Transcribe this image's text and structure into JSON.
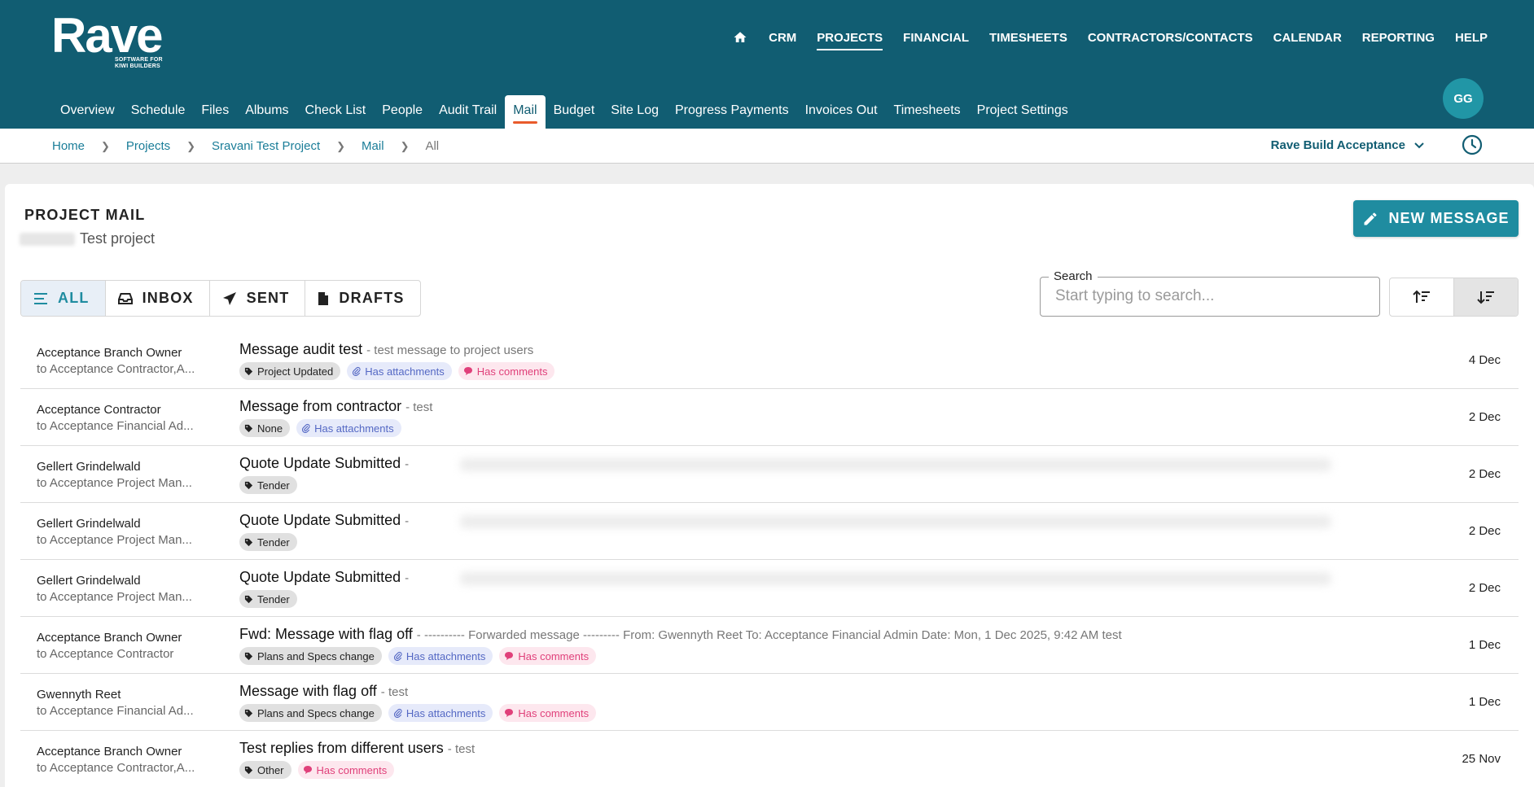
{
  "brand": {
    "name": "Rave",
    "tagline": "SOFTWARE FOR KIWI BUILDERS"
  },
  "topnav": {
    "items": [
      "CRM",
      "PROJECTS",
      "FINANCIAL",
      "TIMESHEETS",
      "CONTRACTORS/CONTACTS",
      "CALENDAR",
      "REPORTING",
      "HELP"
    ],
    "active": "PROJECTS"
  },
  "user": {
    "initials": "GG"
  },
  "subnav": {
    "tabs": [
      "Overview",
      "Schedule",
      "Files",
      "Albums",
      "Check List",
      "People",
      "Audit Trail",
      "Mail",
      "Budget",
      "Site Log",
      "Progress Payments",
      "Invoices Out",
      "Timesheets",
      "Project Settings"
    ],
    "active": "Mail"
  },
  "breadcrumb": [
    "Home",
    "Projects",
    "Sravani Test Project",
    "Mail",
    "All"
  ],
  "project_selector": {
    "value": "Rave Build Acceptance"
  },
  "page": {
    "title": "PROJECT MAIL",
    "subtitle": "Test project",
    "new_message_label": "NEW MESSAGE"
  },
  "filters": [
    {
      "label": "ALL",
      "icon": "list-icon",
      "active": true
    },
    {
      "label": "INBOX",
      "icon": "inbox-icon",
      "active": false
    },
    {
      "label": "SENT",
      "icon": "send-icon",
      "active": false
    },
    {
      "label": "DRAFTS",
      "icon": "file-icon",
      "active": false
    }
  ],
  "search": {
    "label": "Search",
    "placeholder": "Start typing to search...",
    "value": ""
  },
  "messages": [
    {
      "from": "Acceptance Branch Owner",
      "to": "to Acceptance Contractor,A...",
      "subject": "Message audit test",
      "preview": "- test message to project users",
      "tag": "Project Updated",
      "attachments_label": "Has attachments",
      "comments_label": "Has comments",
      "date": "4 Dec"
    },
    {
      "from": "Acceptance Contractor",
      "to": "to Acceptance Financial Ad...",
      "subject": "Message from contractor",
      "preview": "- test",
      "tag": "None",
      "attachments_label": "Has attachments",
      "comments_label": null,
      "date": "2 Dec"
    },
    {
      "from": "Gellert Grindelwald",
      "to": "to Acceptance Project Man...",
      "subject": "Quote Update Submitted",
      "preview": "-",
      "tag": "Tender",
      "attachments_label": null,
      "comments_label": null,
      "date": "2 Dec",
      "blurred": true
    },
    {
      "from": "Gellert Grindelwald",
      "to": "to Acceptance Project Man...",
      "subject": "Quote Update Submitted",
      "preview": "-",
      "tag": "Tender",
      "attachments_label": null,
      "comments_label": null,
      "date": "2 Dec",
      "blurred": true
    },
    {
      "from": "Gellert Grindelwald",
      "to": "to Acceptance Project Man...",
      "subject": "Quote Update Submitted",
      "preview": "-",
      "tag": "Tender",
      "attachments_label": null,
      "comments_label": null,
      "date": "2 Dec",
      "blurred": true
    },
    {
      "from": "Acceptance Branch Owner",
      "to": "to Acceptance Contractor",
      "subject": "Fwd: Message with flag off",
      "preview": "-   ---------- Forwarded message --------- From: Gwennyth Reet To: Acceptance Financial Admin Date: Mon, 1 Dec 2025, 9:42 AM     test",
      "tag": "Plans and Specs change",
      "attachments_label": "Has attachments",
      "comments_label": "Has comments",
      "date": "1 Dec"
    },
    {
      "from": "Gwennyth Reet",
      "to": "to Acceptance Financial Ad...",
      "subject": "Message with flag off",
      "preview": "- test",
      "tag": "Plans and Specs change",
      "attachments_label": "Has attachments",
      "comments_label": "Has comments",
      "date": "1 Dec"
    },
    {
      "from": "Acceptance Branch Owner",
      "to": "to Acceptance Contractor,A...",
      "subject": "Test replies from different users",
      "preview": "- test",
      "tag": "Other",
      "attachments_label": null,
      "comments_label": "Has comments",
      "date": "25 Nov"
    }
  ],
  "colors": {
    "header": "#115d72",
    "accent": "#1f8ca0",
    "active_tab_underline": "#e95b2b",
    "attachment_chip": "#5468c4",
    "comment_chip": "#e0407a"
  }
}
